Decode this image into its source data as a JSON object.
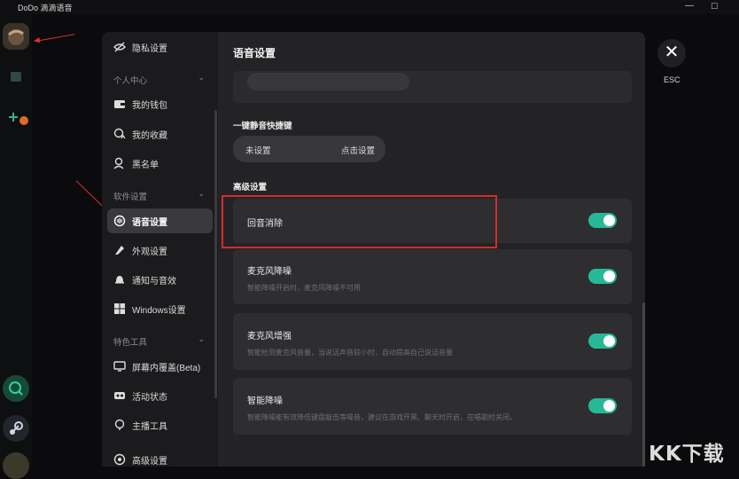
{
  "window": {
    "title": "DoDo 滴滴语音",
    "minimize_glyph": "—",
    "maximize_glyph": "☐"
  },
  "nav": {
    "items": [
      {
        "label": "隐私设置",
        "icon": "privacy-icon"
      },
      {
        "label": "我的钱包",
        "icon": "wallet-icon"
      },
      {
        "label": "我的收藏",
        "icon": "favorite-icon"
      },
      {
        "label": "黑名单",
        "icon": "blacklist-icon"
      },
      {
        "label": "语音设置",
        "icon": "voice-icon",
        "active": true
      },
      {
        "label": "外观设置",
        "icon": "appearance-icon"
      },
      {
        "label": "通知与音效",
        "icon": "bell-icon"
      },
      {
        "label": "Windows设置",
        "icon": "windows-icon"
      },
      {
        "label": "屏幕内覆盖(Beta)",
        "icon": "overlay-icon"
      },
      {
        "label": "活动状态",
        "icon": "activity-icon"
      },
      {
        "label": "主播工具",
        "icon": "streamer-icon"
      },
      {
        "label": "高级设置",
        "icon": "advanced-icon"
      }
    ],
    "groups": {
      "personal": "个人中心",
      "software": "软件设置",
      "special": "特色工具"
    }
  },
  "content": {
    "heading": "语音设置",
    "hotkey": {
      "title": "一键静音快捷键",
      "value": "未设置",
      "action": "点击设置"
    },
    "advanced": {
      "title": "高级设置",
      "options": [
        {
          "title": "回音消除",
          "desc": "",
          "enabled": true
        },
        {
          "title": "麦克风降噪",
          "desc": "智能降噪开启时，麦克风降噪不可用",
          "enabled": true
        },
        {
          "title": "麦克风增强",
          "desc": "智能检测麦克风音量，当说话声音较小时，自动提高自己说话音量",
          "enabled": true
        },
        {
          "title": "智能降噪",
          "desc": "智能降噪能有效降低键盘敲击等噪音，建议在游戏开黑、聊天时开启，在唱歌时关闭。",
          "enabled": true
        }
      ]
    }
  },
  "esc": {
    "glyph": "✕",
    "label": "ESC"
  },
  "watermark": "KK下载",
  "colors": {
    "accent": "#27b897",
    "highlight": "#d22d2d",
    "arrow": "#e03131"
  }
}
